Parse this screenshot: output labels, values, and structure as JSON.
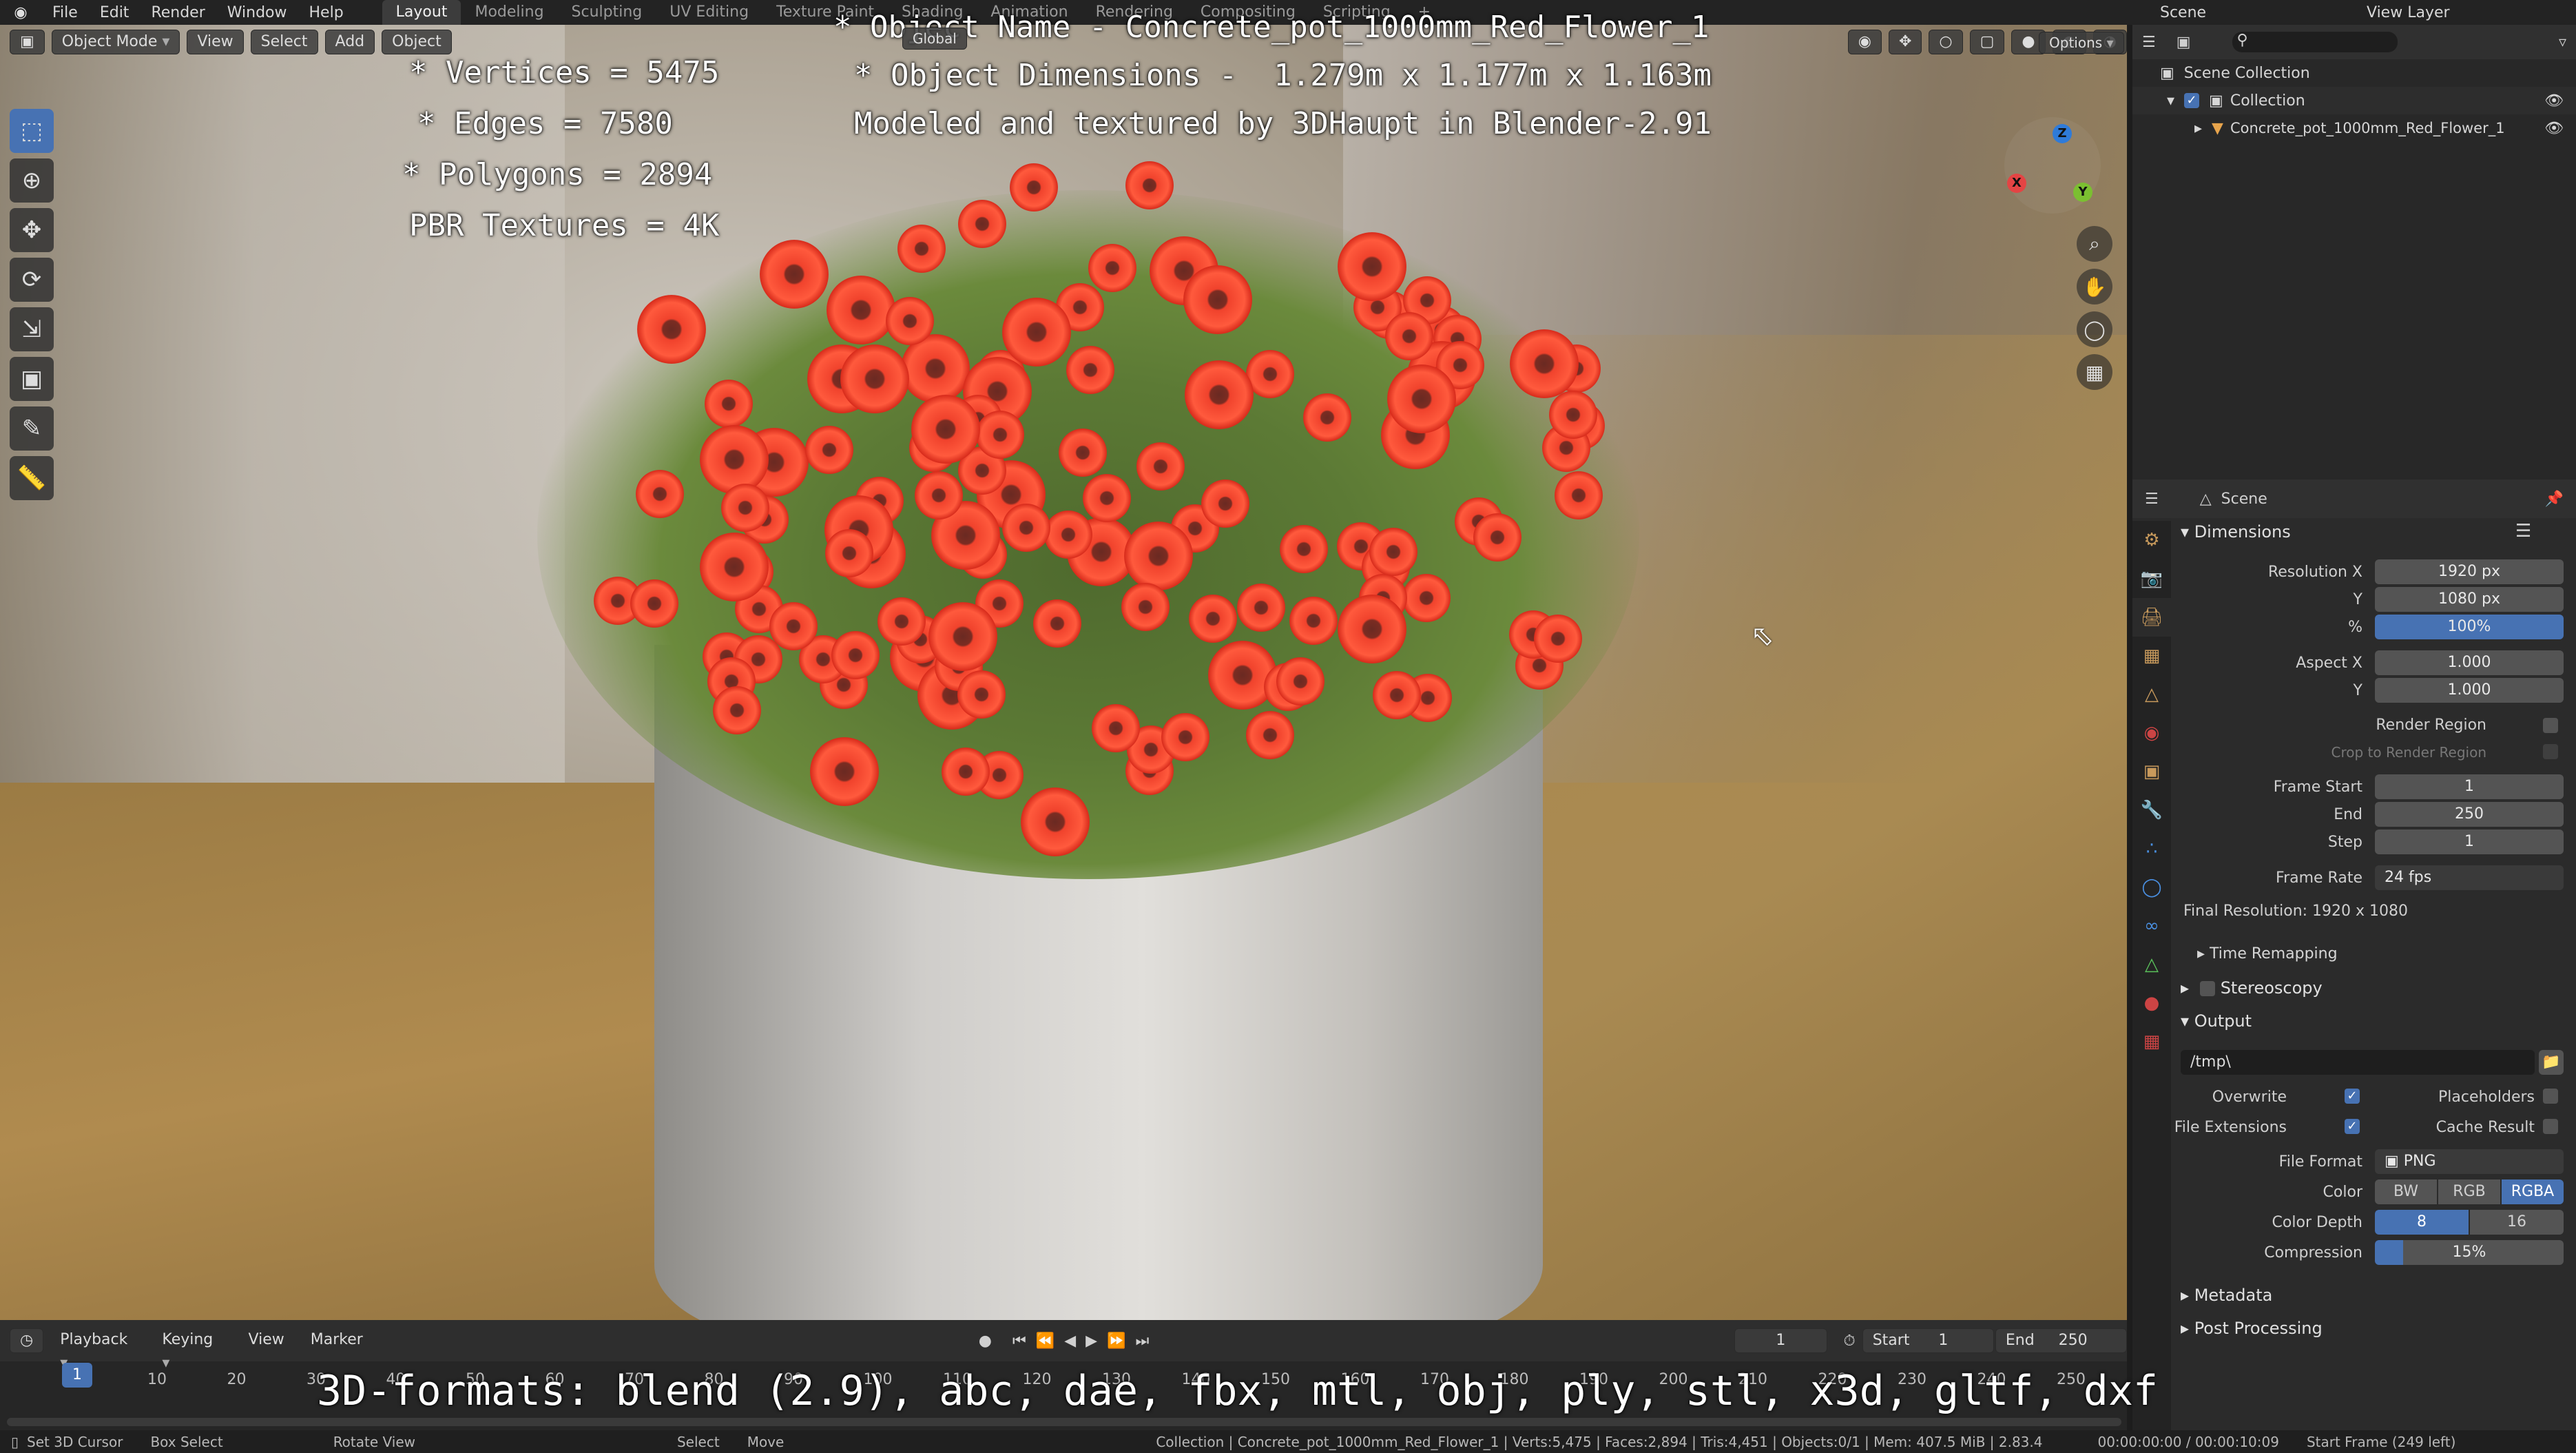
{
  "topbar": {
    "menus": [
      "File",
      "Edit",
      "Render",
      "Window",
      "Help"
    ],
    "workspaces": [
      "Layout",
      "Modeling",
      "Sculpting",
      "UV Editing",
      "Texture Paint",
      "Shading",
      "Animation",
      "Rendering",
      "Compositing",
      "Scripting"
    ],
    "active_workspace": "Layout",
    "scene": "Scene",
    "view_layer": "View Layer"
  },
  "viewport": {
    "mode": "Object Mode",
    "menus": [
      "View",
      "Select",
      "Add",
      "Object"
    ],
    "transform": "Global",
    "options": "Options",
    "overlay_lines_left": [
      "* Vertices = 5475",
      "* Edges = 7580",
      "* Polygons = 2894",
      "PBR Textures = 4K"
    ],
    "overlay_lines_right": [
      "* Object Name - Concrete_pot_1000mm_Red_Flower_1",
      "* Object Dimensions -  1.279m x 1.177m x 1.163m",
      "Modeled and textured by 3DHaupt in Blender-2.91"
    ],
    "bottom_caption": "3D-formats: blend (2.9), abc, dae, fbx, mtl, obj, ply, stl, x3d, gltf, dxf"
  },
  "outliner": {
    "rows": [
      "Scene Collection",
      "Collection",
      "Concrete_pot_1000mm_Red_Flower_1"
    ]
  },
  "properties": {
    "header": "Scene",
    "dimensions": {
      "title": "Dimensions",
      "resolution_x_label": "Resolution X",
      "resolution_x": "1920 px",
      "y_label": "Y",
      "resolution_y": "1080 px",
      "pct_label": "%",
      "resolution_pct": "100%",
      "aspect_x_label": "Aspect X",
      "aspect_x": "1.000",
      "aspect_y_label": "Y",
      "aspect_y": "1.000",
      "render_region": "Render Region",
      "crop": "Crop to Render Region",
      "frame_start_label": "Frame Start",
      "frame_start": "1",
      "end_label": "End",
      "frame_end": "250",
      "step_label": "Step",
      "frame_step": "1",
      "frame_rate_label": "Frame Rate",
      "frame_rate": "24 fps",
      "final_resolution": "Final Resolution: 1920 x 1080",
      "time_remapping": "Time Remapping",
      "stereoscopy": "Stereoscopy"
    },
    "output": {
      "title": "Output",
      "path": "/tmp\\",
      "overwrite": "Overwrite",
      "placeholders": "Placeholders",
      "file_extensions": "File Extensions",
      "cache_result": "Cache Result",
      "file_format_label": "File Format",
      "file_format": "PNG",
      "color_label": "Color",
      "color_modes": [
        "BW",
        "RGB",
        "RGBA"
      ],
      "color_depth_label": "Color Depth",
      "depth_modes": [
        "8",
        "16"
      ],
      "compression_label": "Compression",
      "compression": "15%"
    },
    "metadata": "Metadata",
    "post_processing": "Post Processing"
  },
  "timeline": {
    "menus": [
      "Playback",
      "Keying",
      "View",
      "Marker"
    ],
    "current_frame": "1",
    "start_label": "Start",
    "start": "1",
    "end_label": "End",
    "end": "250",
    "ticks": [
      "10",
      "20",
      "30",
      "40",
      "50",
      "60",
      "70",
      "80",
      "90",
      "100",
      "110",
      "120",
      "130",
      "140",
      "150",
      "160",
      "170",
      "180",
      "190",
      "200",
      "210",
      "220",
      "230",
      "240",
      "250"
    ],
    "playhead": "1"
  },
  "statusbar": {
    "left": [
      "Set 3D Cursor",
      "Box Select",
      "Rotate View",
      "Select",
      "Move"
    ],
    "info": "Collection | Concrete_pot_1000mm_Red_Flower_1 | Verts:5,475 | Faces:2,894 | Tris:4,451 | Objects:0/1 | Mem: 407.5 MiB | 2.83.4",
    "time": "00:00:00:00 / 00:00:10:09",
    "start_frame": "Start Frame (249 left)"
  },
  "colors": {
    "accent": "#4772b3",
    "flower": "#f0422c",
    "panel": "#2b2b2b"
  }
}
